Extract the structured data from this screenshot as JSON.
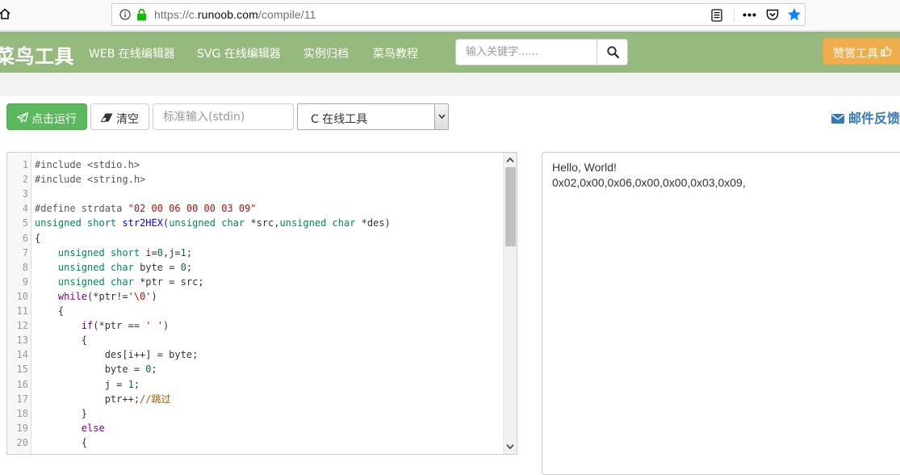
{
  "browser": {
    "url_prefix": "https://c.",
    "url_domain": "runoob.com",
    "url_path": "/compile/11"
  },
  "nav": {
    "logo": "菜鸟工具",
    "links": [
      "WEB 在线编辑器",
      "SVG 在线编辑器",
      "实例归档",
      "菜鸟教程"
    ],
    "search_placeholder": "输入关键字......",
    "donate_label": "赞赏工具"
  },
  "toolbar": {
    "run_label": "点击运行",
    "clear_label": "清空",
    "stdin_placeholder": "标准输入(stdin)",
    "language_selected": "C 在线工具",
    "feedback_label": "邮件反馈"
  },
  "editor": {
    "line_numbers": [
      "1",
      "2",
      "3",
      "4",
      "5",
      "6",
      "7",
      "8",
      "9",
      "10",
      "11",
      "12",
      "13",
      "14",
      "15",
      "16",
      "17",
      "18",
      "19",
      "20"
    ],
    "lines": [
      "#include <stdio.h>",
      "#include <string.h>",
      "",
      "#define strdata \"02 00 06 00 00 03 09\"",
      "unsigned short str2HEX(unsigned char *src,unsigned char *des)",
      "{",
      "    unsigned short i=0,j=1;",
      "    unsigned char byte = 0;",
      "    unsigned char *ptr = src;",
      "    while(*ptr!='\\0')",
      "    {",
      "        if(*ptr == ' ')",
      "        {",
      "            des[i++] = byte;",
      "            byte = 0;",
      "            j = 1;",
      "            ptr++;//跳过",
      "        }",
      "        else",
      "        {"
    ]
  },
  "output": {
    "lines": [
      "Hello, World!",
      "0x02,0x00,0x06,0x00,0x00,0x03,0x09,"
    ]
  },
  "colors": {
    "nav_bg": "#96b97d",
    "run_button": "#5cb85c",
    "donate_button": "#f0ad4e",
    "link_blue": "#337ab7"
  }
}
